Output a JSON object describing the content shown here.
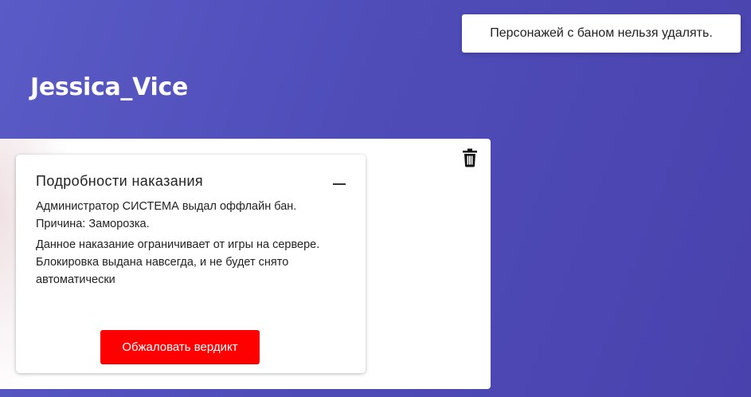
{
  "character": {
    "name": "Jessica_Vice"
  },
  "toast": {
    "message": "Персонажей с баном нельзя удалять."
  },
  "card": {
    "delete_icon": "trash-icon",
    "punishment": {
      "title": "Подробности наказания",
      "collapse_icon": "minus-icon",
      "line1": "Администратор СИСТЕМА выдал оффлайн бан.",
      "line2": "Причина: Заморозка.",
      "line3": "Данное наказание ограничивает от игры на сервере. Блокировка выдана навсегда, и не будет снято автоматически",
      "appeal_label": "Обжаловать вердикт"
    }
  },
  "colors": {
    "accent": "#ff0000",
    "background": "#5a5bc6"
  }
}
